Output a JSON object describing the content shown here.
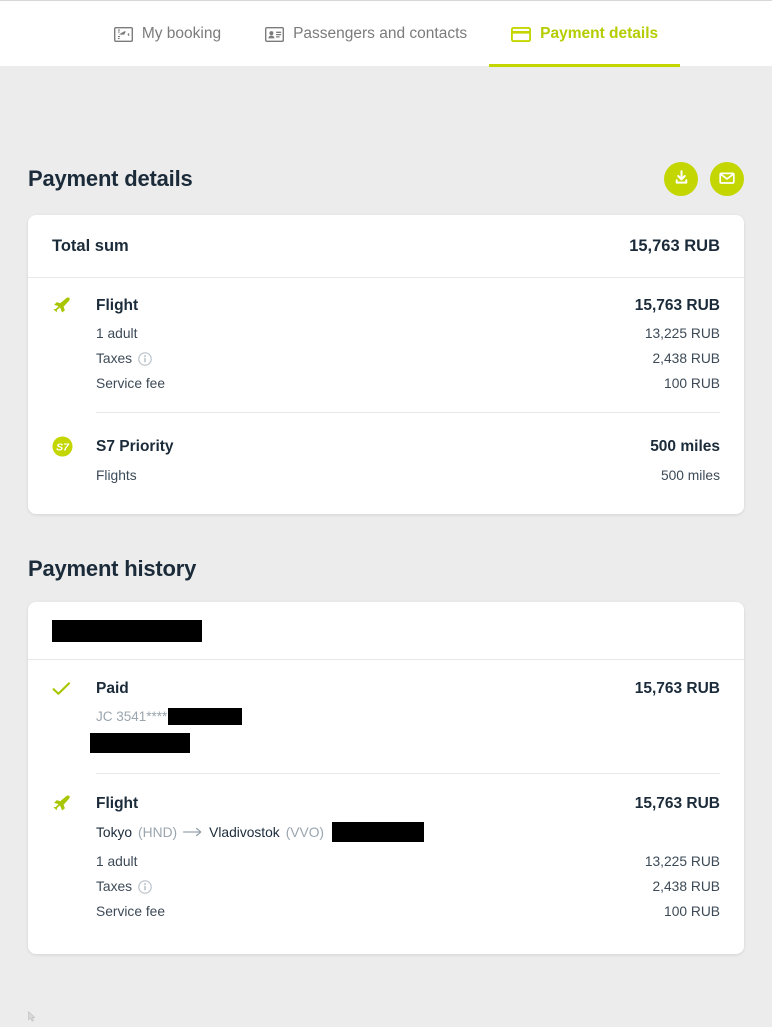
{
  "tabs": [
    {
      "id": "my-booking",
      "label": "My booking",
      "icon": "ticket-plane-icon",
      "active": false
    },
    {
      "id": "passengers-contacts",
      "label": "Passengers and contacts",
      "icon": "id-card-icon",
      "active": false
    },
    {
      "id": "payment-details",
      "label": "Payment details",
      "icon": "credit-card-icon",
      "active": true
    }
  ],
  "header": {
    "title": "Payment details",
    "actions": [
      {
        "id": "download",
        "icon": "download-icon"
      },
      {
        "id": "email",
        "icon": "envelope-icon"
      }
    ]
  },
  "summary": {
    "total_label": "Total sum",
    "total_value": "15,763 RUB",
    "groups": [
      {
        "icon": "airplane-icon",
        "title": "Flight",
        "amount": "15,763 RUB",
        "lines": [
          {
            "label": "1 adult",
            "value": "13,225 RUB",
            "info": false
          },
          {
            "label": "Taxes",
            "value": "2,438 RUB",
            "info": true
          },
          {
            "label": "Service fee",
            "value": "100 RUB",
            "info": false
          }
        ]
      },
      {
        "icon": "s7-logo-icon",
        "title": "S7 Priority",
        "amount": "500 miles",
        "lines": [
          {
            "label": "Flights",
            "value": "500 miles",
            "info": false
          }
        ]
      }
    ]
  },
  "history": {
    "title": "Payment history",
    "top_redacted_width": 150,
    "paid": {
      "icon": "check-icon",
      "label": "Paid",
      "amount": "15,763 RUB",
      "card_prefix": "JC 3541 ",
      "card_mask": "****",
      "card_redacted_width": 74,
      "second_redacted_width": 100
    },
    "flight": {
      "icon": "airplane-icon",
      "title": "Flight",
      "amount": "15,763 RUB",
      "origin_city": "Tokyo",
      "origin_code": "(HND)",
      "arrow": "→",
      "destination_city": "Vladivostok",
      "destination_code": "(VVO)",
      "route_redacted_width": 92,
      "lines": [
        {
          "label": "1 adult",
          "value": "13,225 RUB",
          "info": false
        },
        {
          "label": "Taxes",
          "value": "2,438 RUB",
          "info": true
        },
        {
          "label": "Service fee",
          "value": "100 RUB",
          "info": false
        }
      ]
    }
  },
  "colors": {
    "accent": "#c3d600",
    "accent_text": "#b5cd00",
    "page_bg": "#ececec",
    "card_bg": "#ffffff",
    "text_dark": "#1b2b3a",
    "text_muted": "#9aa5ae"
  }
}
